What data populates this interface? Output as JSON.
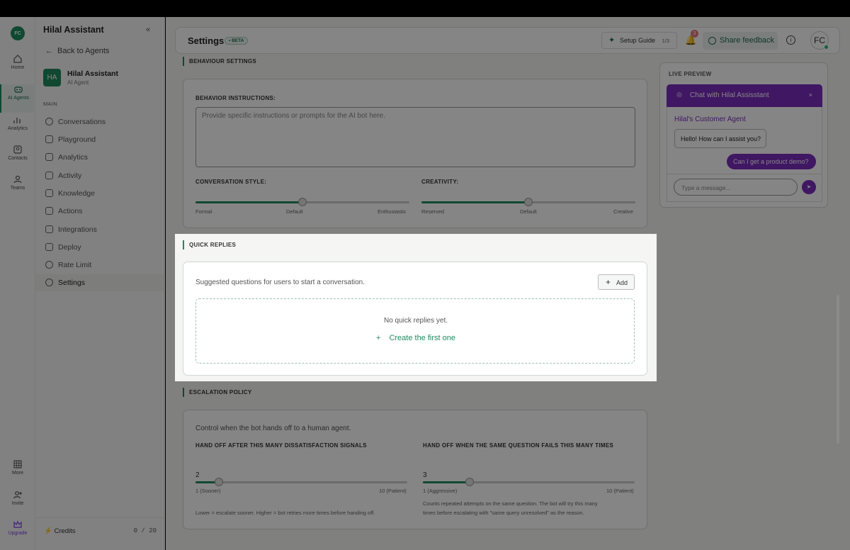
{
  "rail": {
    "logo": "FC",
    "items": [
      {
        "label": "Home",
        "icon": "home-icon"
      },
      {
        "label": "AI Agents",
        "icon": "robot-icon"
      },
      {
        "label": "Analytics",
        "icon": "bar-chart-icon"
      },
      {
        "label": "Contacts",
        "icon": "contacts-icon"
      },
      {
        "label": "Teams",
        "icon": "users-icon"
      },
      {
        "label": "More",
        "icon": "grid-icon"
      },
      {
        "label": "Invite",
        "icon": "user-plus-icon"
      },
      {
        "label": "Upgrade",
        "icon": "crown-icon"
      }
    ]
  },
  "sidebar": {
    "title": "Hilal Assistant",
    "back": "Back to Agents",
    "agent": {
      "initials": "HA",
      "name": "Hilal Assistant",
      "type": "AI Agent"
    },
    "section": "MAIN",
    "items": [
      "Conversations",
      "Playground",
      "Analytics",
      "Activity",
      "Knowledge",
      "Actions",
      "Integrations",
      "Deploy",
      "Rate Limit",
      "Settings"
    ],
    "credits_label": "Credits",
    "credits_value": "0 / 20"
  },
  "header": {
    "title": "Settings",
    "beta": "• BETA",
    "setup_guide": "Setup Guide",
    "setup_count": "1/3",
    "notif_count": "3",
    "share_feedback": "Share feedback",
    "avatar": "FC"
  },
  "behaviour": {
    "section": "BEHAVIOUR SETTINGS",
    "instructions_label": "BEHAVIOR INSTRUCTIONS:",
    "instructions_placeholder": "Provide specific instructions or prompts for the AI bot here.",
    "style_label": "CONVERSATION STYLE:",
    "style_min": "Formal",
    "style_mid": "Default",
    "style_max": "Enthusiastic",
    "style_value": 0.5,
    "creativity_label": "CREATIVITY:",
    "creativity_min": "Reserved",
    "creativity_mid": "Default",
    "creativity_max": "Creative",
    "creativity_value": 0.5
  },
  "preview": {
    "label": "LIVE PREVIEW",
    "chat_title": "Chat with Hilal Assisstant",
    "agent_name": "Hilal's Customer Agent",
    "bot_msg": "Hello! How can I assist you?",
    "user_msg": "Can I get a product demo?",
    "input_placeholder": "Type a message..."
  },
  "quick": {
    "section": "QUICK REPLIES",
    "desc": "Suggested questions for users to start a conversation.",
    "add": "Add",
    "empty": "No quick replies yet.",
    "create": "Create the first one"
  },
  "escalation": {
    "section": "ESCALATION POLICY",
    "desc": "Control when the bot hands off to a human agent.",
    "left_label": "HAND OFF AFTER THIS MANY DISSATISFACTION SIGNALS",
    "left_value": "2",
    "left_min": "1 (Sooner)",
    "left_max": "10 (Patient)",
    "left_note": "Lower = escalate sooner. Higher = bot retries more times before handing off.",
    "right_label": "HAND OFF WHEN THE SAME QUESTION FAILS THIS MANY TIMES",
    "right_value": "3",
    "right_min": "1 (Aggressive)",
    "right_max": "10 (Patient)",
    "right_note1": "Counts repeated attempts on the same question. The bot will try this many",
    "right_note2": "times before escalating with \"same query unresolved\" as the reason."
  }
}
